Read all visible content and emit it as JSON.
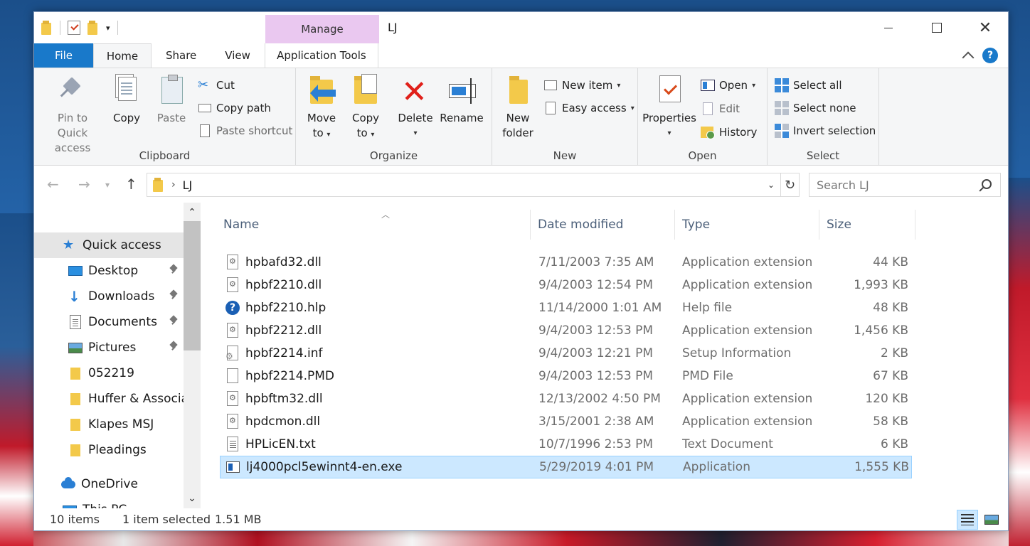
{
  "window": {
    "title": "LJ",
    "context_tab": "Manage"
  },
  "tabs": {
    "file": "File",
    "home": "Home",
    "share": "Share",
    "view": "View",
    "app_tools": "Application Tools"
  },
  "ribbon": {
    "clipboard": {
      "label": "Clipboard",
      "pin_line1": "Pin to Quick",
      "pin_line2": "access",
      "copy": "Copy",
      "paste": "Paste",
      "cut": "Cut",
      "copy_path": "Copy path",
      "paste_shortcut": "Paste shortcut"
    },
    "organize": {
      "label": "Organize",
      "move_line1": "Move",
      "move_line2": "to",
      "copy_line1": "Copy",
      "copy_line2": "to",
      "delete": "Delete",
      "rename": "Rename"
    },
    "new": {
      "label": "New",
      "folder_line1": "New",
      "folder_line2": "folder",
      "new_item": "New item",
      "easy_access": "Easy access"
    },
    "open": {
      "label": "Open",
      "properties": "Properties",
      "open": "Open",
      "edit": "Edit",
      "history": "History"
    },
    "select": {
      "label": "Select",
      "select_all": "Select all",
      "select_none": "Select none",
      "invert": "Invert selection"
    }
  },
  "address": {
    "path": "LJ",
    "search_placeholder": "Search LJ"
  },
  "navpane": {
    "items": [
      {
        "label": "Quick access",
        "icon": "star-icon"
      },
      {
        "label": "Desktop",
        "icon": "desktop-icon"
      },
      {
        "label": "Downloads",
        "icon": "downloads-icon"
      },
      {
        "label": "Documents",
        "icon": "documents-icon"
      },
      {
        "label": "Pictures",
        "icon": "pictures-icon"
      },
      {
        "label": "052219",
        "icon": "folder-icon"
      },
      {
        "label": "Huffer & Associa",
        "icon": "folder-icon"
      },
      {
        "label": "Klapes MSJ",
        "icon": "folder-icon"
      },
      {
        "label": "Pleadings",
        "icon": "folder-icon"
      },
      {
        "label": "OneDrive",
        "icon": "onedrive-icon"
      },
      {
        "label": "This PC",
        "icon": "pc-icon"
      }
    ]
  },
  "columns": {
    "name": "Name",
    "date": "Date modified",
    "type": "Type",
    "size": "Size"
  },
  "files": [
    {
      "name": "hpbafd32.dll",
      "date": "7/11/2003 7:35 AM",
      "type": "Application extension",
      "size": "44 KB"
    },
    {
      "name": "hpbf2210.dll",
      "date": "9/4/2003 12:54 PM",
      "type": "Application extension",
      "size": "1,993 KB"
    },
    {
      "name": "hpbf2210.hlp",
      "date": "11/14/2000 1:01 AM",
      "type": "Help file",
      "size": "48 KB"
    },
    {
      "name": "hpbf2212.dll",
      "date": "9/4/2003 12:53 PM",
      "type": "Application extension",
      "size": "1,456 KB"
    },
    {
      "name": "hpbf2214.inf",
      "date": "9/4/2003 12:21 PM",
      "type": "Setup Information",
      "size": "2 KB"
    },
    {
      "name": "hpbf2214.PMD",
      "date": "9/4/2003 12:53 PM",
      "type": "PMD File",
      "size": "67 KB"
    },
    {
      "name": "hpbftm32.dll",
      "date": "12/13/2002 4:50 PM",
      "type": "Application extension",
      "size": "120 KB"
    },
    {
      "name": "hpdcmon.dll",
      "date": "3/15/2001 2:38 AM",
      "type": "Application extension",
      "size": "58 KB"
    },
    {
      "name": "HPLicEN.txt",
      "date": "10/7/1996 2:53 PM",
      "type": "Text Document",
      "size": "6 KB"
    },
    {
      "name": "lj4000pcl5ewinnt4-en.exe",
      "date": "5/29/2019 4:01 PM",
      "type": "Application",
      "size": "1,555 KB"
    }
  ],
  "status": {
    "count": "10 items",
    "selected": "1 item selected",
    "size": "1.51 MB"
  },
  "colors": {
    "accent": "#1979ca",
    "selection": "#cce8ff",
    "manage_tab": "#eac8f0"
  }
}
